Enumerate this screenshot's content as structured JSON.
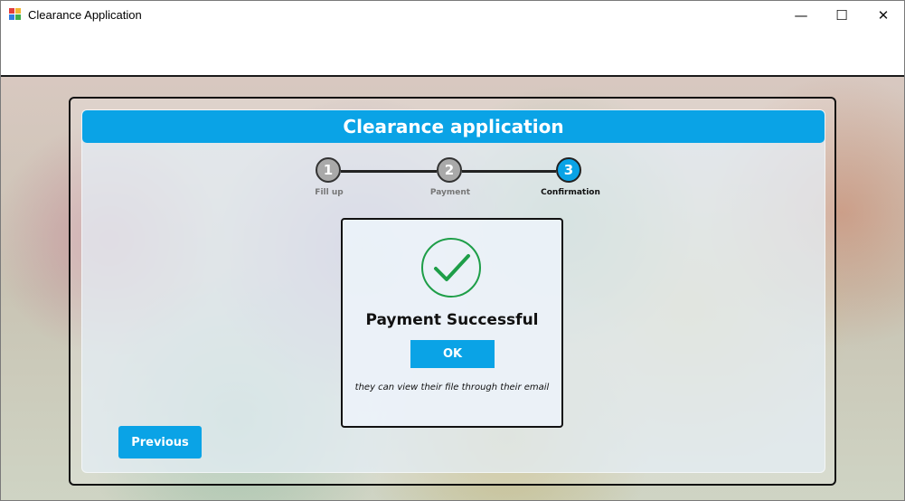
{
  "window": {
    "title": "Clearance Application",
    "controls": {
      "minimize": "—",
      "maximize": "☐",
      "close": "✕"
    }
  },
  "header": {
    "title": "Clearance application"
  },
  "stepper": {
    "steps": [
      {
        "number": "1",
        "label": "Fill up",
        "state": "done"
      },
      {
        "number": "2",
        "label": "Payment",
        "state": "done"
      },
      {
        "number": "3",
        "label": "Confirmation",
        "state": "active"
      }
    ]
  },
  "dialog": {
    "icon": "checkmark-icon",
    "title": "Payment Successful",
    "ok_label": "OK",
    "note": "they can view their file through their email"
  },
  "footer": {
    "previous_label": "Previous"
  },
  "colors": {
    "accent": "#0aa3e6",
    "success": "#1e9e48",
    "step_done": "#a9a9a9"
  }
}
